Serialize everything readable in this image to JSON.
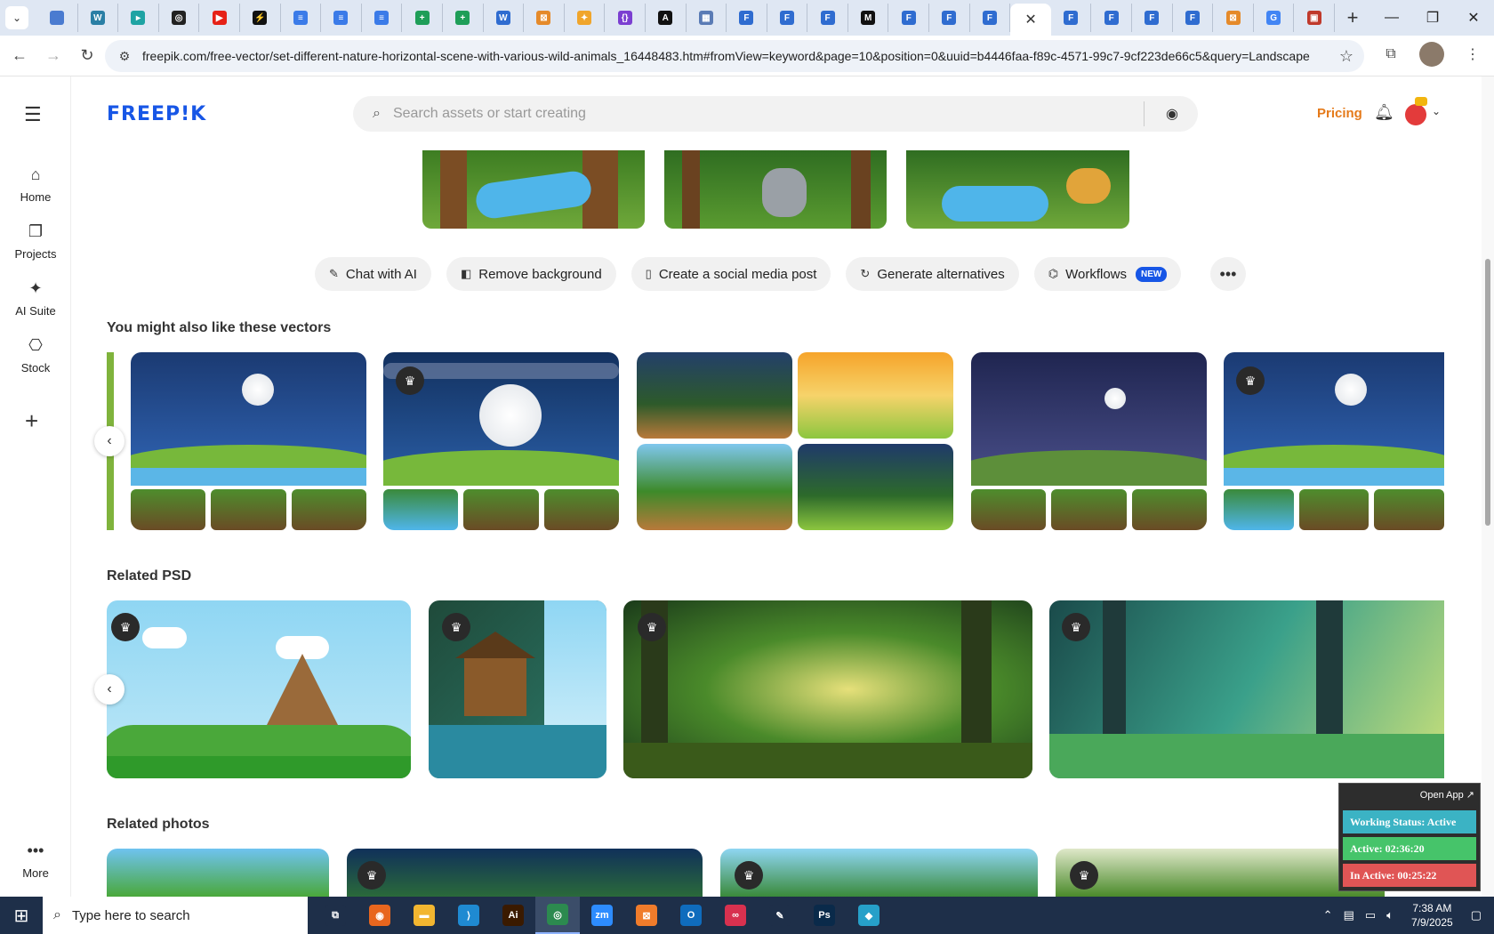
{
  "browser": {
    "url": "freepik.com/free-vector/set-different-nature-horizontal-scene-with-various-wild-animals_16448483.htm#fromView=keyword&page=10&position=0&uuid=b4446faa-f89c-4571-99c7-9cf223de66c5&query=Landscape",
    "tab_favicons": [
      {
        "icon": "globe-icon",
        "color": "#4a7bd0",
        "glyph": ""
      },
      {
        "icon": "vpn-icon",
        "color": "#2a7fa5",
        "glyph": "W"
      },
      {
        "icon": "app-icon",
        "color": "#1ea3a3",
        "glyph": "▸"
      },
      {
        "icon": "openai-icon",
        "color": "#222222",
        "glyph": "◎"
      },
      {
        "icon": "youtube-icon",
        "color": "#e62117",
        "glyph": "▶"
      },
      {
        "icon": "bolt-icon",
        "color": "#111111",
        "glyph": "⚡"
      },
      {
        "icon": "docs-icon",
        "color": "#3b7be8",
        "glyph": "≡"
      },
      {
        "icon": "docs-icon",
        "color": "#3b7be8",
        "glyph": "≡"
      },
      {
        "icon": "docs-icon",
        "color": "#3b7be8",
        "glyph": "≡"
      },
      {
        "icon": "sheets-icon",
        "color": "#1e9e58",
        "glyph": "+"
      },
      {
        "icon": "sheets-icon",
        "color": "#1e9e58",
        "glyph": "+"
      },
      {
        "icon": "word-icon",
        "color": "#2f6cd0",
        "glyph": "W"
      },
      {
        "icon": "box-icon",
        "color": "#e58a2a",
        "glyph": "⊠"
      },
      {
        "icon": "star-icon",
        "color": "#f0a52b",
        "glyph": "✦"
      },
      {
        "icon": "code-icon",
        "color": "#7b3fd1",
        "glyph": "{}"
      },
      {
        "icon": "ai-icon",
        "color": "#111111",
        "glyph": "A"
      },
      {
        "icon": "grid-icon",
        "color": "#5a7bb5",
        "glyph": "▦"
      },
      {
        "icon": "forms-icon",
        "color": "#2f6cd0",
        "glyph": "F"
      },
      {
        "icon": "forms-icon",
        "color": "#2f6cd0",
        "glyph": "F"
      },
      {
        "icon": "forms-icon",
        "color": "#2f6cd0",
        "glyph": "F"
      },
      {
        "icon": "medium-icon",
        "color": "#111111",
        "glyph": "M"
      },
      {
        "icon": "forms-icon",
        "color": "#2f6cd0",
        "glyph": "F"
      },
      {
        "icon": "forms-icon",
        "color": "#2f6cd0",
        "glyph": "F"
      },
      {
        "icon": "forms-icon",
        "color": "#2f6cd0",
        "glyph": "F"
      },
      {
        "icon": "close-icon",
        "color": "#ffffff",
        "glyph": "✕",
        "active": true
      },
      {
        "icon": "forms-icon",
        "color": "#2f6cd0",
        "glyph": "F"
      },
      {
        "icon": "forms-icon",
        "color": "#2f6cd0",
        "glyph": "F"
      },
      {
        "icon": "forms-icon",
        "color": "#2f6cd0",
        "glyph": "F"
      },
      {
        "icon": "forms-icon",
        "color": "#2f6cd0",
        "glyph": "F"
      },
      {
        "icon": "box-icon",
        "color": "#e58a2a",
        "glyph": "⊠"
      },
      {
        "icon": "google-icon",
        "color": "#4285f4",
        "glyph": "G"
      },
      {
        "icon": "image-icon",
        "color": "#c0392b",
        "glyph": "▣"
      }
    ]
  },
  "rail": {
    "items": [
      {
        "label": "Home",
        "icon": "home-icon",
        "glyph": "⌂"
      },
      {
        "label": "Projects",
        "icon": "projects-icon",
        "glyph": "❐"
      },
      {
        "label": "AI Suite",
        "icon": "sparkle-icon",
        "glyph": "✦"
      },
      {
        "label": "Stock",
        "icon": "stock-icon",
        "glyph": "⎔"
      }
    ],
    "more_label": "More"
  },
  "header": {
    "logo": "FREEP!K",
    "search_placeholder": "Search assets or start creating",
    "pricing": "Pricing"
  },
  "actions": [
    {
      "label": "Chat with AI",
      "icon": "chat-icon",
      "glyph": "✎"
    },
    {
      "label": "Remove background",
      "icon": "remove-bg-icon",
      "glyph": "◧"
    },
    {
      "label": "Create a social media post",
      "icon": "phone-icon",
      "glyph": "▯"
    },
    {
      "label": "Generate alternatives",
      "icon": "refresh-icon",
      "glyph": "↻"
    },
    {
      "label": "Workflows",
      "icon": "workflow-icon",
      "glyph": "⌬",
      "badge": "NEW"
    }
  ],
  "sections": {
    "vectors_title": "You might also like these vectors",
    "psd_title": "Related PSD",
    "photos_title": "Related photos"
  },
  "tracker": {
    "open_app": "Open App ↗",
    "status": "Working Status: Active",
    "active": "Active: 02:36:20",
    "inactive": "In Active: 00:25:22",
    "colors": {
      "status": "#3bb3c4",
      "active": "#46c46a",
      "inactive": "#e05555"
    }
  },
  "taskbar": {
    "search_text": "Type here to search",
    "time": "7:38 AM",
    "date": "7/9/2025",
    "apps": [
      {
        "icon": "task-view-icon",
        "color": "#1e2f49",
        "glyph": "⧉"
      },
      {
        "icon": "firefox-icon",
        "color": "#e8661e",
        "glyph": "◉"
      },
      {
        "icon": "file-explorer-icon",
        "color": "#f2b630",
        "glyph": "▬"
      },
      {
        "icon": "vscode-icon",
        "color": "#1f8ad2",
        "glyph": "⟩"
      },
      {
        "icon": "illustrator-icon",
        "color": "#3a1a00",
        "glyph": "Ai"
      },
      {
        "icon": "chrome-icon",
        "color": "#2c8a4f",
        "glyph": "◎",
        "active": true
      },
      {
        "icon": "zoom-icon",
        "color": "#2d8cff",
        "glyph": "zm"
      },
      {
        "icon": "xampp-icon",
        "color": "#f07c2b",
        "glyph": "⊠"
      },
      {
        "icon": "outlook-icon",
        "color": "#0f6cbd",
        "glyph": "O"
      },
      {
        "icon": "creative-cloud-icon",
        "color": "#d8314f",
        "glyph": "∞"
      },
      {
        "icon": "pen-icon",
        "color": "#1e2f49",
        "glyph": "✎"
      },
      {
        "icon": "photoshop-icon",
        "color": "#0a2a4a",
        "glyph": "Ps"
      },
      {
        "icon": "app-icon",
        "color": "#26a0c9",
        "glyph": "◆"
      }
    ]
  }
}
